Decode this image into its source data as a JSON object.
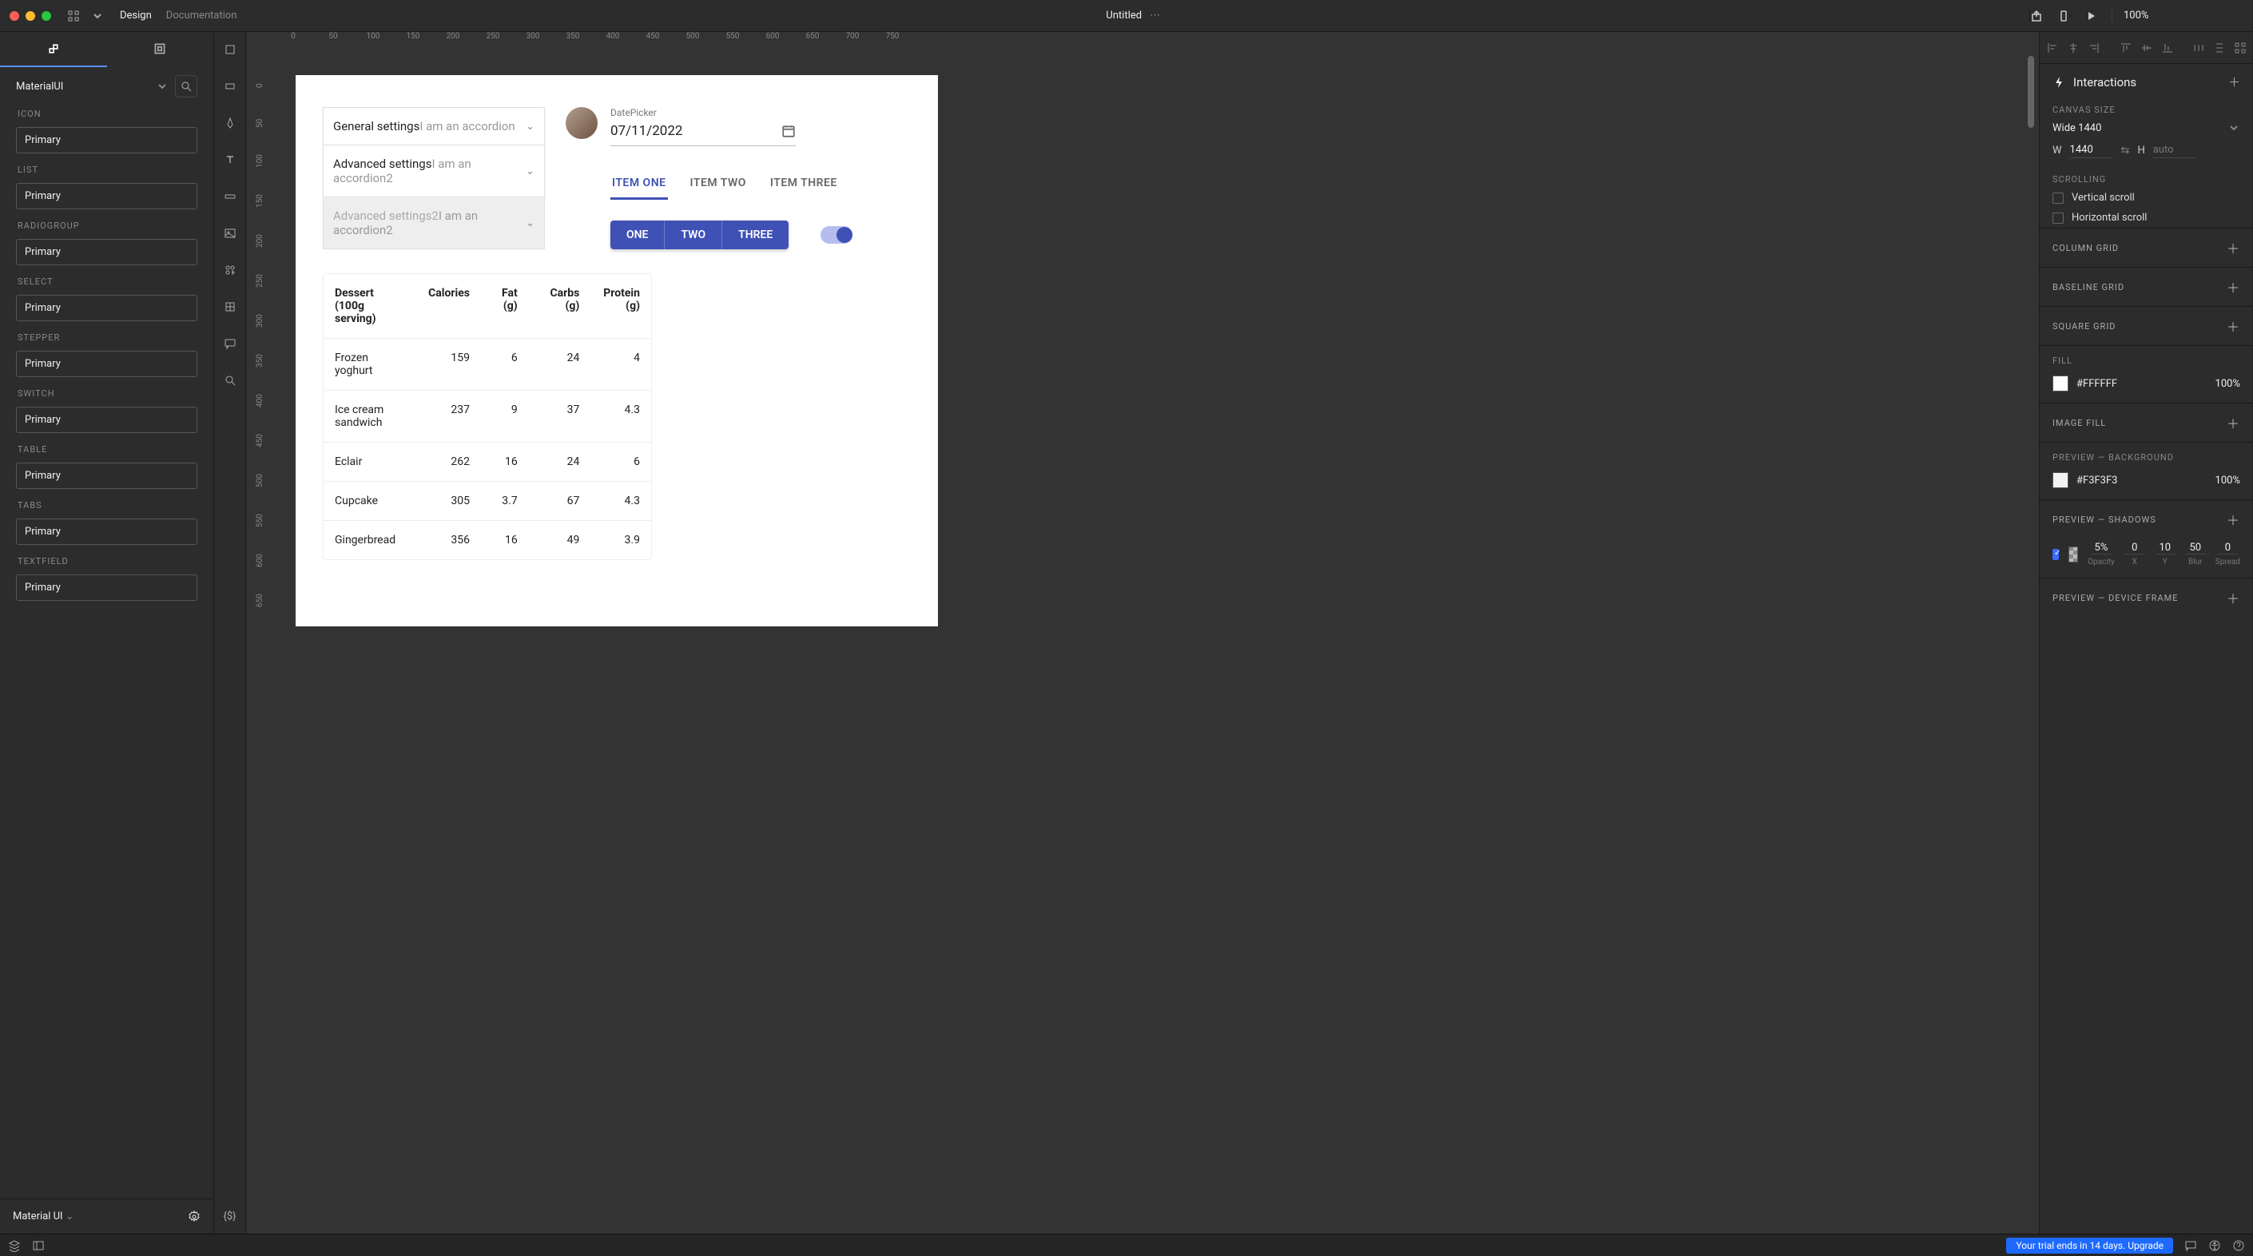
{
  "titlebar": {
    "tabs": [
      "Design",
      "Documentation"
    ],
    "doc_title": "Untitled",
    "zoom": "100%"
  },
  "left": {
    "library": "MaterialUI",
    "categories": [
      {
        "label": "ICON",
        "chip": "Primary"
      },
      {
        "label": "LIST",
        "chip": "Primary"
      },
      {
        "label": "RADIOGROUP",
        "chip": "Primary"
      },
      {
        "label": "SELECT",
        "chip": "Primary"
      },
      {
        "label": "STEPPER",
        "chip": "Primary"
      },
      {
        "label": "SWITCH",
        "chip": "Primary"
      },
      {
        "label": "TABLE",
        "chip": "Primary"
      },
      {
        "label": "TABS",
        "chip": "Primary"
      },
      {
        "label": "TEXTFIELD",
        "chip": "Primary"
      }
    ],
    "footer": "Material UI"
  },
  "ruler_h": [
    "0",
    "50",
    "100",
    "150",
    "200",
    "250",
    "300",
    "350",
    "400",
    "450",
    "500",
    "550",
    "600",
    "650",
    "700",
    "750"
  ],
  "ruler_v": [
    "0",
    "50",
    "100",
    "150",
    "200",
    "250",
    "300",
    "350",
    "400",
    "450",
    "500",
    "550",
    "600",
    "650"
  ],
  "artboard": {
    "accordions": [
      {
        "title": "General settings",
        "sub": "I am an accordion",
        "disabled": false
      },
      {
        "title": "Advanced settings",
        "sub": "I am an accordion2",
        "disabled": false
      },
      {
        "title": "Advanced settings2",
        "sub": "I am an accordion2",
        "disabled": true
      }
    ],
    "datepicker": {
      "label": "DatePicker",
      "value": "07/11/2022"
    },
    "tabs": [
      "ITEM ONE",
      "ITEM TWO",
      "ITEM THREE"
    ],
    "buttons": [
      "ONE",
      "TWO",
      "THREE"
    ],
    "table": {
      "headers": [
        "Dessert (100g serving)",
        "Calories",
        "Fat (g)",
        "Carbs (g)",
        "Protein (g)"
      ],
      "rows": [
        [
          "Frozen yoghurt",
          "159",
          "6",
          "24",
          "4"
        ],
        [
          "Ice cream sandwich",
          "237",
          "9",
          "37",
          "4.3"
        ],
        [
          "Eclair",
          "262",
          "16",
          "24",
          "6"
        ],
        [
          "Cupcake",
          "305",
          "3.7",
          "67",
          "4.3"
        ],
        [
          "Gingerbread",
          "356",
          "16",
          "49",
          "3.9"
        ]
      ]
    }
  },
  "right": {
    "interactions": "Interactions",
    "canvas_size_label": "CANVAS SIZE",
    "canvas_preset": "Wide 1440",
    "width_label": "W",
    "width": "1440",
    "height_label": "H",
    "height": "auto",
    "scrolling_label": "SCROLLING",
    "vscroll": "Vertical scroll",
    "hscroll": "Horizontal scroll",
    "column_grid": "COLUMN GRID",
    "baseline_grid": "BASELINE GRID",
    "square_grid": "SQUARE GRID",
    "fill_label": "FILL",
    "fill_hex": "#FFFFFF",
    "fill_opacity": "100%",
    "image_fill": "IMAGE FILL",
    "preview_bg": "PREVIEW — BACKGROUND",
    "preview_hex": "#F3F3F3",
    "preview_opacity": "100%",
    "preview_shadows": "PREVIEW — SHADOWS",
    "shadow": {
      "opacity": "5%",
      "x": "0",
      "y": "10",
      "blur": "50",
      "spread": "0"
    },
    "shadow_labels": {
      "opacity": "Opacity",
      "x": "X",
      "y": "Y",
      "blur": "Blur",
      "spread": "Spread"
    },
    "preview_device": "PREVIEW — DEVICE FRAME"
  },
  "bottom": {
    "trial": "Your trial ends in 14 days. Upgrade"
  }
}
